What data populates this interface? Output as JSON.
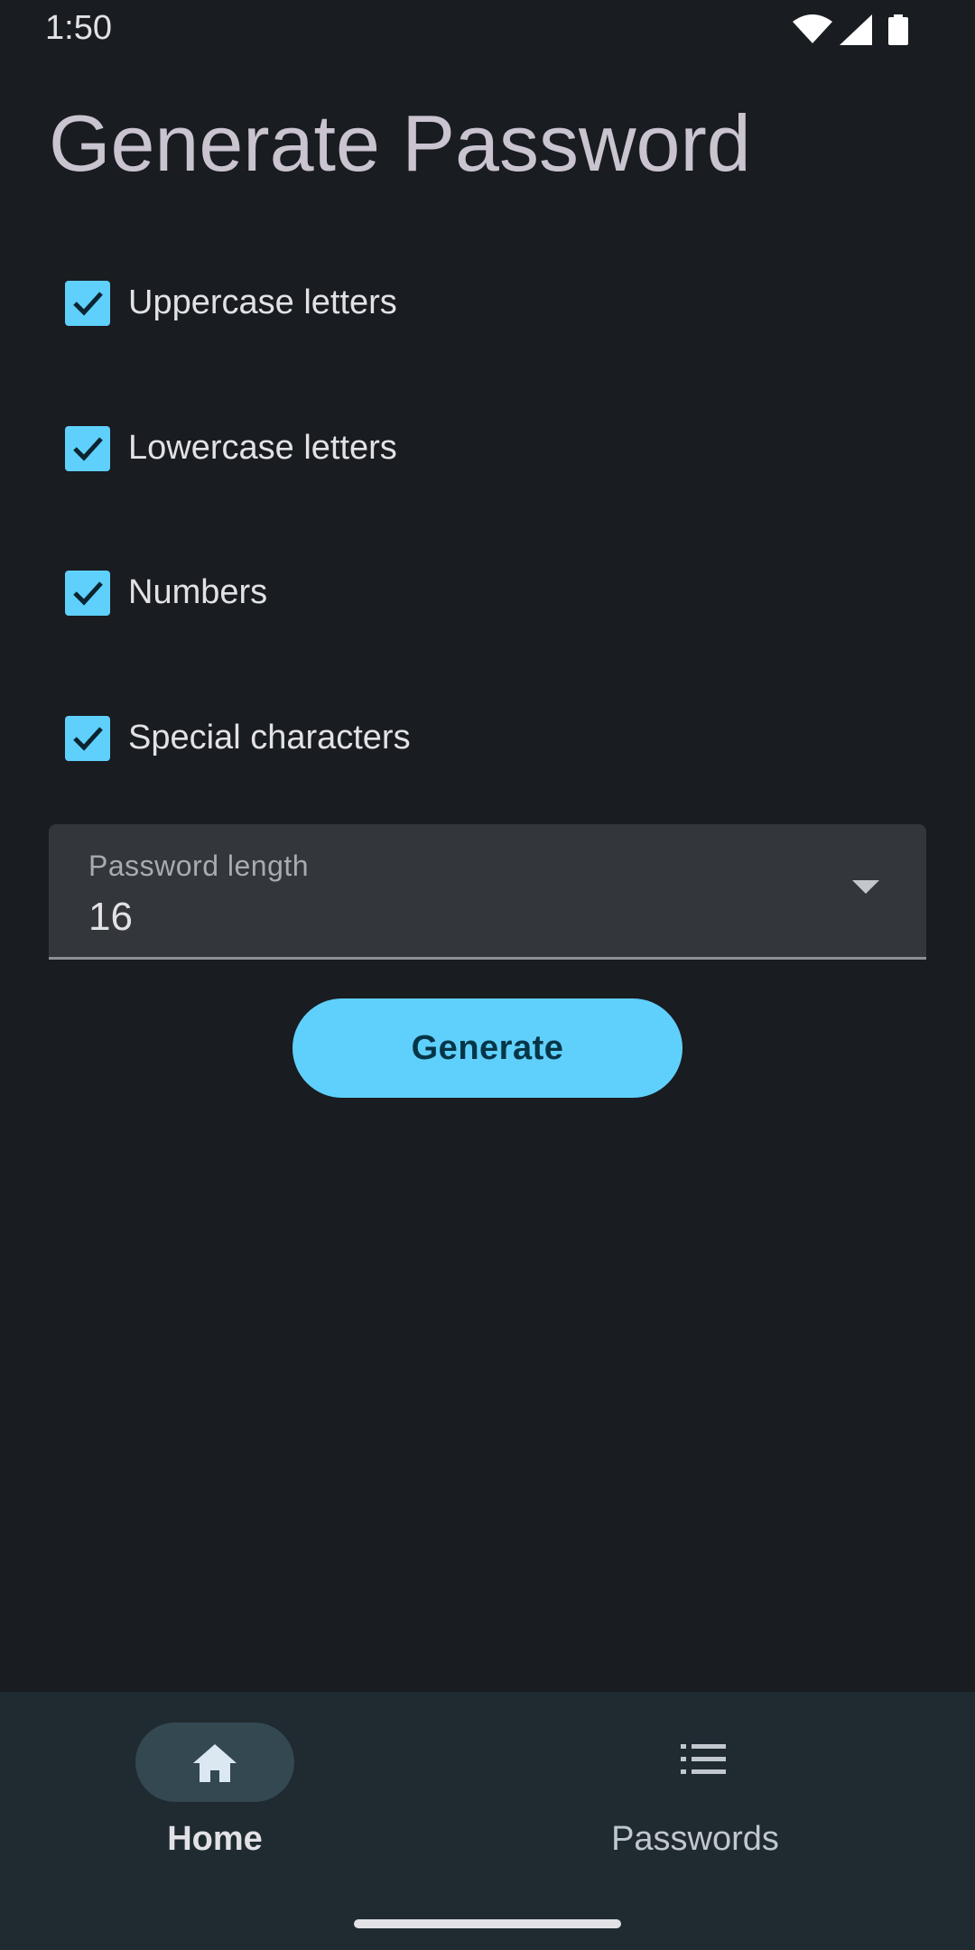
{
  "status_bar": {
    "time": "1:50",
    "icons": [
      "wifi-icon",
      "cellular-signal-icon",
      "battery-icon"
    ]
  },
  "page": {
    "title": "Generate Password"
  },
  "options": [
    {
      "label": "Uppercase letters",
      "checked": true
    },
    {
      "label": "Lowercase letters",
      "checked": true
    },
    {
      "label": "Numbers",
      "checked": true
    },
    {
      "label": "Special characters",
      "checked": true
    }
  ],
  "length_field": {
    "label": "Password length",
    "value": "16"
  },
  "generate_button": {
    "label": "Generate"
  },
  "bottom_nav": {
    "items": [
      {
        "label": "Home",
        "icon": "home-icon",
        "selected": true
      },
      {
        "label": "Passwords",
        "icon": "list-icon",
        "selected": false
      }
    ]
  },
  "colors": {
    "background": "#191c20",
    "accent": "#5fd0fb",
    "nav_background": "#1f2a31",
    "nav_pill": "#344852"
  }
}
